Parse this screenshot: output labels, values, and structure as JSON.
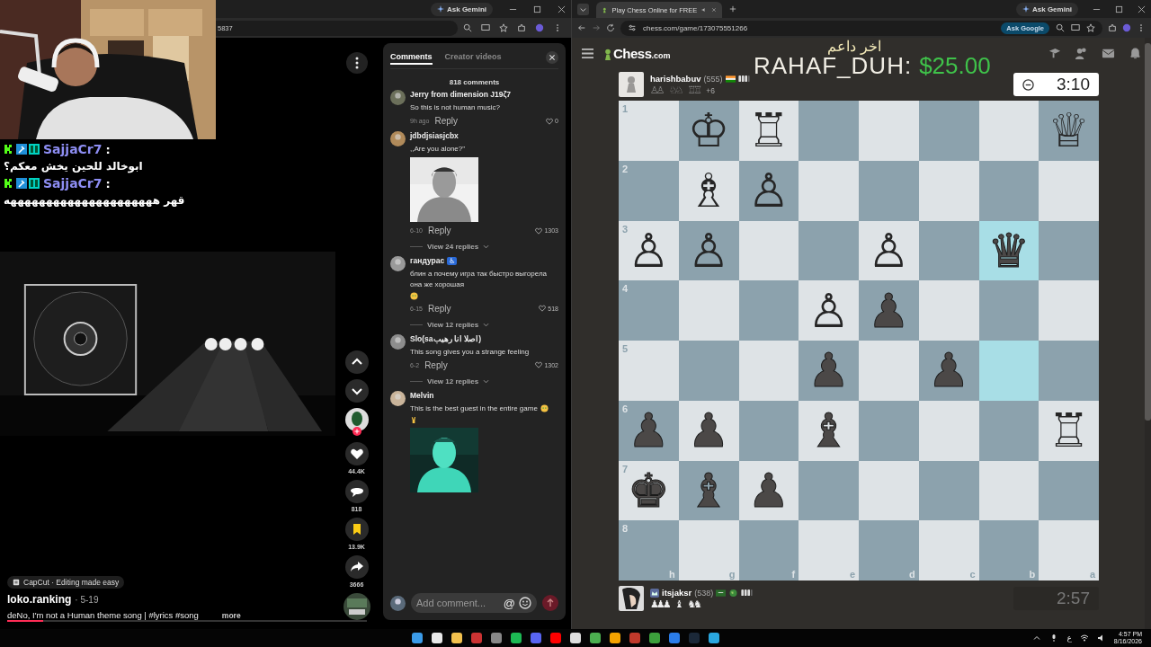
{
  "left_browser": {
    "ask_gemini": "Ask Gemini",
    "address": "5837"
  },
  "chat": [
    {
      "user": "SajjaCr7",
      "separator": ":",
      "message": "ابوخالد للحين يخش معكم؟"
    },
    {
      "user": "SajjaCr7",
      "separator": ":",
      "message": "قهر هههههههههههههههههههههه"
    }
  ],
  "video": {
    "actions": [
      {
        "kind": "up"
      },
      {
        "kind": "down"
      },
      {
        "kind": "avatar"
      },
      {
        "kind": "like",
        "count": "44.4K"
      },
      {
        "kind": "comment",
        "count": "818"
      },
      {
        "kind": "bookmark",
        "count": "13.9K"
      },
      {
        "kind": "share",
        "count": "3666"
      },
      {
        "kind": "music"
      }
    ],
    "effect": "CapCut · Editing made easy",
    "author": "loko.ranking",
    "date": "· 5-19",
    "caption": "deNo, I'm not a Human theme song | #lyrics #song",
    "more": "more",
    "progress": {
      "level": 0.1
    }
  },
  "comments_panel": {
    "tabs": [
      {
        "label": "Comments",
        "selected": true
      },
      {
        "label": "Creator videos",
        "selected": false
      }
    ],
    "count": "818 comments",
    "comments": [
      {
        "author": "Jerry from dimension J19ζ7",
        "text": "So this is not human music?",
        "date": "9h ago",
        "reply": "Reply",
        "likes": "0"
      },
      {
        "author": "jdbdjsiasjcbx",
        "text": ",,Are you alone?\"",
        "image": {
          "kind": "picture"
        },
        "date": "6-10",
        "reply": "Reply",
        "likes": "1303",
        "replies": "View 24 replies"
      },
      {
        "author": "гандурас",
        "badge": "♿",
        "text": "блин а почему игра так быстро выгорела она же хорошая",
        "emojis": [
          {
            "kind": "face"
          }
        ],
        "date": "6-15",
        "reply": "Reply",
        "likes": "518",
        "replies": "View 12 replies"
      },
      {
        "author": "Slo(saاصلا انا رهيب)",
        "text": "This song gives you a strange feeling",
        "date": "6-2",
        "reply": "Reply",
        "likes": "1302",
        "replies": "View 12 replies"
      },
      {
        "author": "Melvin",
        "text": "This is the best guest in the entire game",
        "emojis": [
          {
            "kind": "face"
          },
          {
            "kind": "hand"
          }
        ],
        "image": {
          "kind": "picture"
        }
      }
    ],
    "input": {
      "placeholder": "Add comment...",
      "mention": "@"
    }
  },
  "right_browser": {
    "tab": "Play Chess Online for FREE",
    "ask_gemini": "Ask Gemini",
    "address": "chess.com/game/173075551266",
    "ask_google": "Ask Google"
  },
  "donation": {
    "heading": "اخر داعم",
    "name": "RAHAF_DUH:",
    "amount": "$25.00"
  },
  "chess": {
    "logo": "Chess",
    "logo_suffix": ".com",
    "top_player": {
      "name": "harishbabuv",
      "rating": "(555)",
      "captured": [
        "♙♙",
        "♘♘",
        "♖♖"
      ],
      "advantage": "+6",
      "clock": "3:10",
      "active": true
    },
    "bottom_player": {
      "name": "itsjaksr",
      "rating": "(538)",
      "captured": [
        "♟♟♟",
        "♝",
        "♞♞"
      ],
      "clock": "2:57",
      "active": false
    }
  },
  "board": {
    "files": [
      "h",
      "g",
      "f",
      "e",
      "d",
      "c",
      "b",
      "a"
    ],
    "ranks": [
      {
        "label": "1",
        "squares": [
          {
            "highlighted": false
          },
          {
            "piece": "♔",
            "kind": "white",
            "highlighted": false
          },
          {
            "piece": "♖",
            "kind": "white",
            "highlighted": false
          },
          {
            "highlighted": false
          },
          {
            "highlighted": false
          },
          {
            "highlighted": false
          },
          {
            "highlighted": false
          },
          {
            "piece": "♕",
            "kind": "white",
            "highlighted": false
          }
        ]
      },
      {
        "label": "2",
        "squares": [
          {
            "highlighted": false
          },
          {
            "piece": "♗",
            "kind": "white",
            "highlighted": false
          },
          {
            "piece": "♙",
            "kind": "white",
            "highlighted": false
          },
          {
            "highlighted": false
          },
          {
            "highlighted": false
          },
          {
            "highlighted": false
          },
          {
            "highlighted": false
          },
          {
            "highlighted": false
          }
        ]
      },
      {
        "label": "3",
        "squares": [
          {
            "piece": "♙",
            "kind": "white",
            "highlighted": false
          },
          {
            "piece": "♙",
            "kind": "white",
            "highlighted": false
          },
          {
            "highlighted": false
          },
          {
            "highlighted": false
          },
          {
            "piece": "♙",
            "kind": "white",
            "highlighted": false
          },
          {
            "highlighted": false
          },
          {
            "piece": "♛",
            "kind": "black",
            "highlighted": true
          },
          {
            "highlighted": false
          }
        ]
      },
      {
        "label": "4",
        "squares": [
          {
            "highlighted": false
          },
          {
            "highlighted": false
          },
          {
            "highlighted": false
          },
          {
            "piece": "♙",
            "kind": "white",
            "highlighted": false
          },
          {
            "piece": "♟",
            "kind": "black",
            "highlighted": false
          },
          {
            "highlighted": false
          },
          {
            "highlighted": false
          },
          {
            "highlighted": false
          }
        ]
      },
      {
        "label": "5",
        "squares": [
          {
            "highlighted": false
          },
          {
            "highlighted": false
          },
          {
            "highlighted": false
          },
          {
            "piece": "♟",
            "kind": "black",
            "highlighted": false
          },
          {
            "highlighted": false
          },
          {
            "piece": "♟",
            "kind": "black",
            "highlighted": false
          },
          {
            "highlighted": true
          },
          {
            "highlighted": false
          }
        ]
      },
      {
        "label": "6",
        "squares": [
          {
            "piece": "♟",
            "kind": "black",
            "highlighted": false
          },
          {
            "piece": "♟",
            "kind": "black",
            "highlighted": false
          },
          {
            "highlighted": false
          },
          {
            "piece": "♝",
            "kind": "black",
            "highlighted": false
          },
          {
            "highlighted": false
          },
          {
            "highlighted": false
          },
          {
            "highlighted": false
          },
          {
            "piece": "♖",
            "kind": "white",
            "highlighted": false
          }
        ]
      },
      {
        "label": "7",
        "squares": [
          {
            "piece": "♚",
            "kind": "black",
            "highlighted": false
          },
          {
            "piece": "♝",
            "kind": "black",
            "highlighted": false
          },
          {
            "piece": "♟",
            "kind": "black",
            "highlighted": false
          },
          {
            "highlighted": false
          },
          {
            "highlighted": false
          },
          {
            "highlighted": false
          },
          {
            "highlighted": false
          },
          {
            "highlighted": false
          }
        ]
      },
      {
        "label": "8",
        "squares": [
          {
            "highlighted": false
          },
          {
            "highlighted": false
          },
          {
            "highlighted": false
          },
          {
            "highlighted": false
          },
          {
            "highlighted": false
          },
          {
            "highlighted": false
          },
          {
            "highlighted": false
          },
          {
            "highlighted": false
          }
        ]
      }
    ]
  },
  "tray": {
    "language": "ع",
    "time": "4:57 PM",
    "date": "8/16/2026"
  }
}
